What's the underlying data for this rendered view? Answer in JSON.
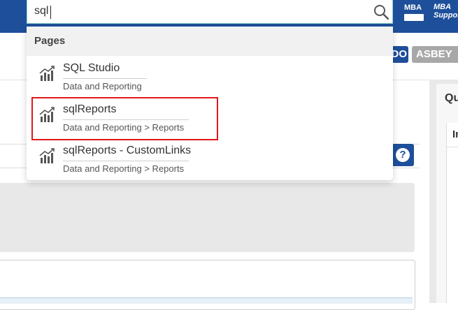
{
  "header": {
    "logo_text": "MBA",
    "support_text": "MBA Support"
  },
  "user_buttons": {
    "left_fragment": "DO",
    "user_label": "ASBEY"
  },
  "right_panel": {
    "title_fragment": "Qu",
    "inner_fragment": "In"
  },
  "help_button": {
    "glyph": "?"
  },
  "search": {
    "value": "sql",
    "icon": "search-icon"
  },
  "dropdown": {
    "section_title": "Pages",
    "results": [
      {
        "title": "SQL Studio",
        "subtitle": "Data and Reporting",
        "icon": "chart-trend-icon"
      },
      {
        "title": "sqlReports",
        "subtitle": "Data and Reporting > Reports",
        "icon": "chart-trend-icon"
      },
      {
        "title": "sqlReports - CustomLinks",
        "subtitle": "Data and Reporting > Reports",
        "icon": "chart-trend-icon"
      }
    ]
  },
  "colors": {
    "brand_blue": "#1e4f9a",
    "highlight_red": "#e0181c",
    "search_border": "#8fd4cc"
  }
}
